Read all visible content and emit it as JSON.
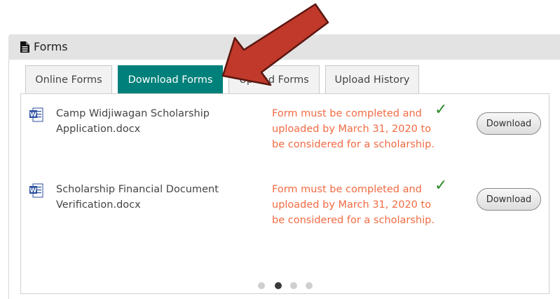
{
  "panel": {
    "title": "Forms",
    "icon": "document-icon"
  },
  "tabs": [
    {
      "label": "Online Forms",
      "active": false
    },
    {
      "label": "Download Forms",
      "active": true
    },
    {
      "label": "Upload Forms",
      "active": false
    },
    {
      "label": "Upload History",
      "active": false
    }
  ],
  "forms": [
    {
      "icon": "word-document-icon",
      "name": "Camp Widjiwagan Scholarship Application.docx",
      "notice": "Form must be completed and uploaded by March 31, 2020 to be considered for a scholarship.",
      "status_icon": "checkmark-icon",
      "button_label": "Download"
    },
    {
      "icon": "word-document-icon",
      "name": "Scholarship Financial Document Verification.docx",
      "notice": "Form must be completed and uploaded by March 31, 2020 to be considered for a scholarship.",
      "status_icon": "checkmark-icon",
      "button_label": "Download"
    }
  ],
  "pager": {
    "count": 4,
    "active_index": 1
  },
  "colors": {
    "active_tab": "#00807a",
    "notice_text": "#f26b43",
    "check": "#2a8a2a",
    "arrow": "#c0392b"
  }
}
